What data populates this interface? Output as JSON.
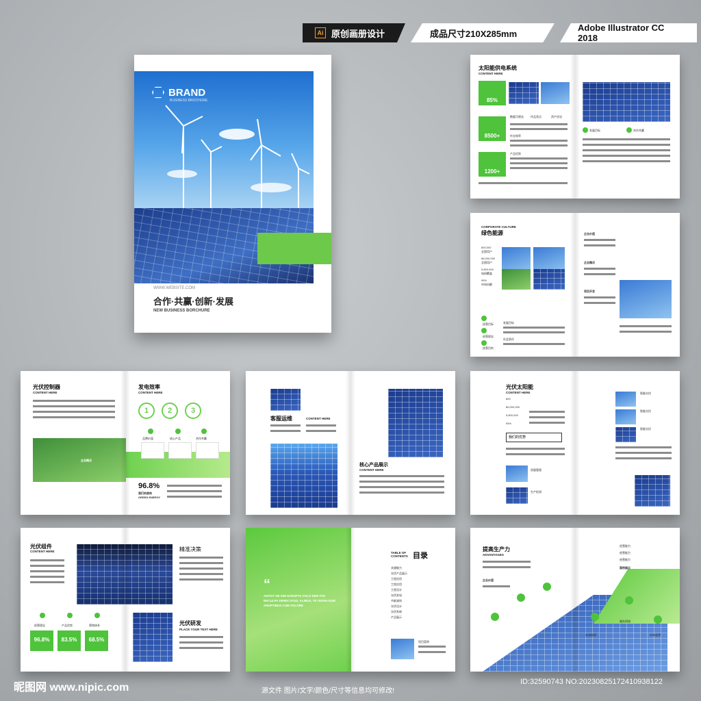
{
  "header": {
    "tag1": "原创画册设计",
    "tag1_icon": "Ai",
    "tag2": "成品尺寸210X285mm",
    "tag3": "Adobe Illustrator CC 2018"
  },
  "cover": {
    "brand": "BRAND",
    "brand_sub": "BUSINESS BROCHURE",
    "website": "WWW.WEBSITE.COM",
    "title": "合作·共赢·创新·发展",
    "subtitle": "NEW BUSINESS BORCHURE"
  },
  "spread1": {
    "title": "太阳能供电系统",
    "sub": "CONTENT HERE",
    "stats": [
      "85%",
      "8500+",
      "1200+"
    ],
    "labels": [
      "数据可视化",
      "作品亮点",
      "资产优化",
      "作业效率",
      "产品优势"
    ],
    "goals": [
      "发展目标",
      "合作共赢"
    ]
  },
  "spread2": {
    "title_en": "CORPORATE CULTURE",
    "title": "绿色能源",
    "numbers": [
      "800,000",
      "86,000,000",
      "5,800,000",
      "95%"
    ],
    "number_labels": [
      "全国用户",
      "全国用户",
      "电网覆盖",
      "市场份额"
    ],
    "right_headers": [
      "企业价值",
      "企业概况",
      "项目开发"
    ],
    "labels": [
      "经营目标",
      "经营理念",
      "经营目的",
      "发展目标",
      "社会责任"
    ]
  },
  "spread3": {
    "title": "光伏控制器",
    "sub": "CONTENT HERE",
    "title2": "发电效率",
    "sub2": "CONTENT HERE",
    "circles": [
      "1",
      "2",
      "3"
    ],
    "icons": [
      "品牌价值",
      "核心产品",
      "合作共赢"
    ],
    "overlay": "企业概况",
    "stat": "96.8%",
    "stat_label": "我们的使命",
    "stat_sub": "GREEN ENERGY"
  },
  "spread4": {
    "title": "客服运维",
    "sub": "CONTENT HERE",
    "title2": "核心产品展示",
    "sub2": "CONTENT HERE"
  },
  "spread5": {
    "title": "光伏太阳能",
    "sub": "CONTENT HERE",
    "numbers": [
      "800",
      "86,000,000",
      "5,800,000",
      "95%"
    ],
    "box": "我们的优势",
    "labels": [
      "智能光伏",
      "智能光伏",
      "智能光伏",
      "质量管理",
      "生产检测"
    ]
  },
  "spread6": {
    "title": "光伏组件",
    "sub": "CONTENT HERE",
    "h1": "精准决策",
    "h2": "光伏研发",
    "h2_sub": "PLACE YOUR TEXT HERE",
    "stats": [
      "96.8%",
      "83.5%",
      "68.5%"
    ],
    "stat_labels": [
      "经营理念",
      "产品优势",
      "营销体系"
    ]
  },
  "spread7": {
    "quote_mark": "“",
    "quote": "ADITAT AB SIM HARUPTA VOLO DER ITIO NECULPA DERECATUS, ALIBUS, TE ODION EUM ARUPTIBUS CUM VOLORE",
    "vertical": "TABLE OF CONTENTS",
    "toc_en": "TABLE OF CONTENTS",
    "toc_title": "目录",
    "toc_items": [
      "关键能力",
      "光伏产品展示",
      "工程应用",
      "工程应用",
      "工程设计",
      "光伏发电",
      "节能减排",
      "光伏设计",
      "光伏系统",
      "产品展示"
    ],
    "caption": "项目案例"
  },
  "spread8": {
    "title": "提高生产力",
    "sub": "ADVANTAGES",
    "h1": "案例展示",
    "h2": "企业价值",
    "labels": [
      "经营能力",
      "经营能力",
      "经营能力",
      "服务网络",
      "未来展望",
      "未来展望"
    ]
  },
  "footer": {
    "logo": "昵图网 www.nipic.com",
    "note": "源文件 图片/文字/颜色/尺寸等信息均可修改!",
    "id": "ID:32590743 NO:20230825172410938122"
  }
}
